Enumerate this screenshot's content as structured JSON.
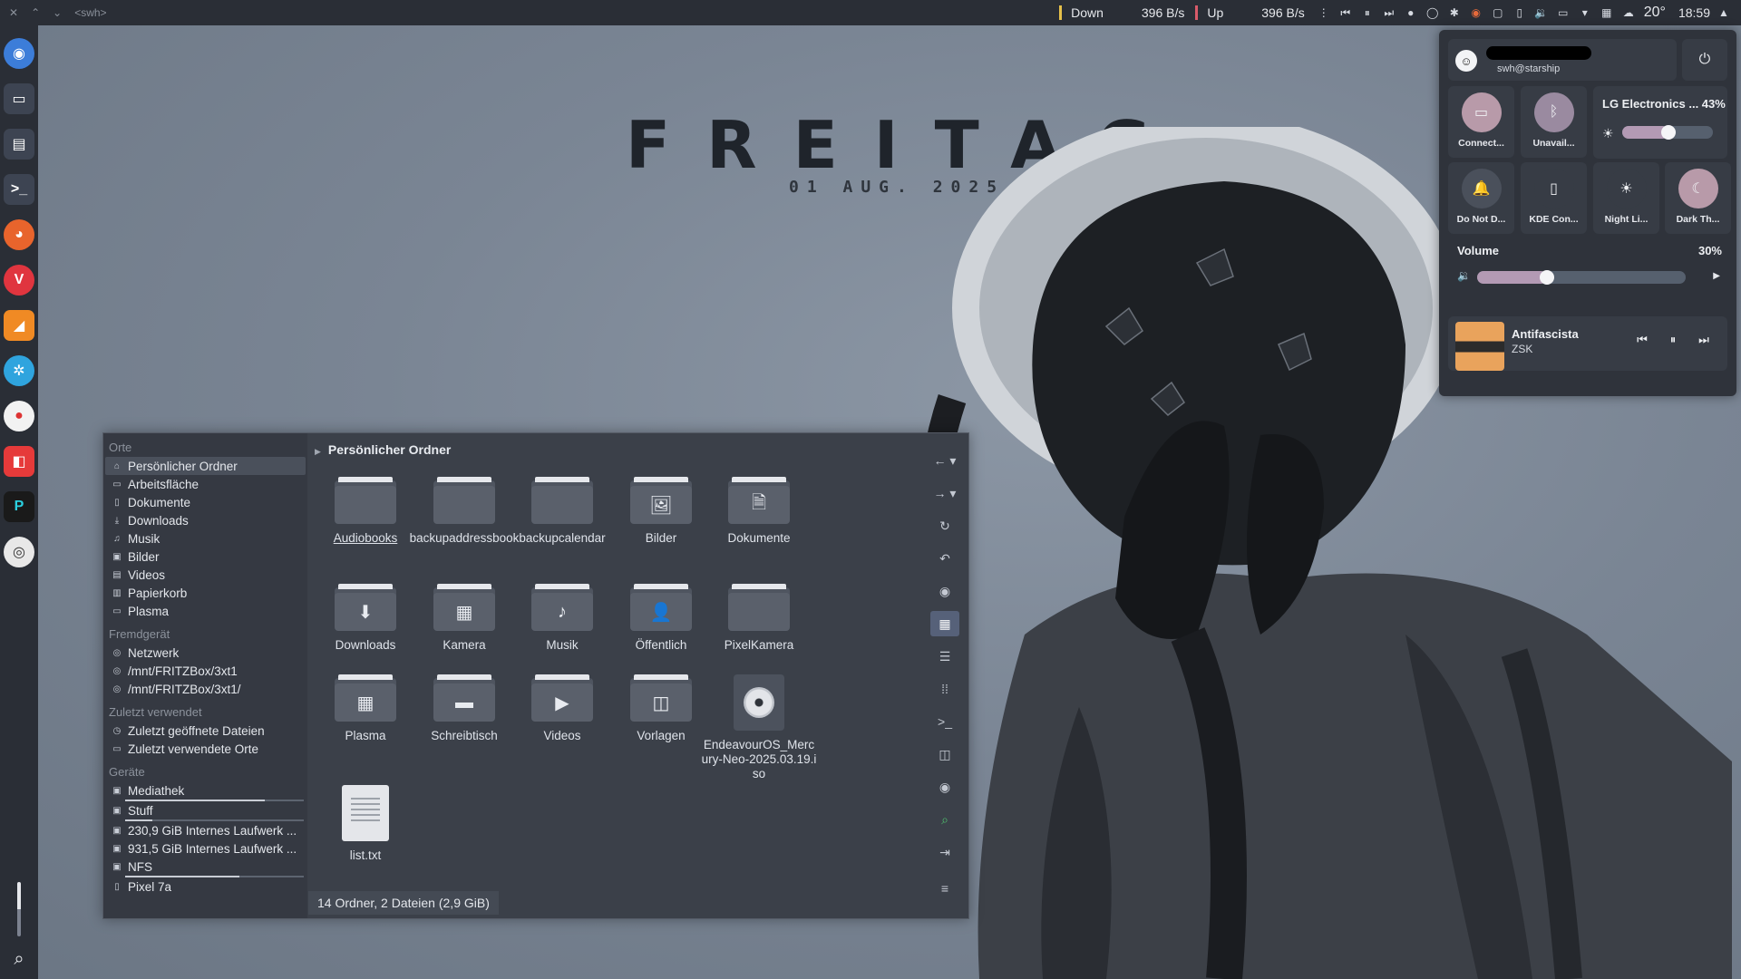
{
  "top_panel": {
    "window_title": "<swh>",
    "down_label": "Down",
    "down_rate": "396 B/s",
    "up_label": "Up",
    "up_rate": "396 B/s",
    "temperature": "20°",
    "clock": "18:59"
  },
  "wallpaper": {
    "title": "FREITAG",
    "date": "01 AUG. 2025"
  },
  "dock": {
    "items": [
      "browser",
      "window",
      "file-manager",
      "terminal",
      "firefox",
      "vivaldi",
      "rss",
      "app",
      "strawberry",
      "app",
      "app",
      "app"
    ]
  },
  "file_manager": {
    "sections": {
      "places": "Orte",
      "remote": "Fremdgerät",
      "recent": "Zuletzt verwendet",
      "devices": "Geräte"
    },
    "places": [
      {
        "label": "Persönlicher Ordner",
        "icon": "home-icon",
        "active": true
      },
      {
        "label": "Arbeitsfläche",
        "icon": "desktop-icon"
      },
      {
        "label": "Dokumente",
        "icon": "document-icon"
      },
      {
        "label": "Downloads",
        "icon": "download-icon"
      },
      {
        "label": "Musik",
        "icon": "music-icon"
      },
      {
        "label": "Bilder",
        "icon": "image-icon"
      },
      {
        "label": "Videos",
        "icon": "video-icon"
      },
      {
        "label": "Papierkorb",
        "icon": "trash-icon"
      },
      {
        "label": "Plasma",
        "icon": "folder-icon"
      }
    ],
    "remote": [
      {
        "label": "Netzwerk",
        "icon": "network-icon"
      },
      {
        "label": "/mnt/FRITZBox/3xt1",
        "icon": "network-icon"
      },
      {
        "label": "/mnt/FRITZBox/3xt1/",
        "icon": "network-icon"
      }
    ],
    "recent": [
      {
        "label": "Zuletzt geöffnete Dateien",
        "icon": "clock-icon"
      },
      {
        "label": "Zuletzt verwendete Orte",
        "icon": "folder-icon"
      }
    ],
    "devices": [
      {
        "label": "Mediathek",
        "icon": "drive-icon",
        "fill": 0.78
      },
      {
        "label": "Stuff",
        "icon": "drive-icon",
        "fill": 0.15
      },
      {
        "label": "230,9 GiB Internes Laufwerk ...",
        "icon": "drive-icon"
      },
      {
        "label": "931,5 GiB Internes Laufwerk ...",
        "icon": "drive-icon"
      },
      {
        "label": "NFS",
        "icon": "drive-icon",
        "fill": 0.64
      },
      {
        "label": "Pixel 7a",
        "icon": "phone-icon"
      }
    ],
    "breadcrumb": "Persönlicher Ordner",
    "files": [
      {
        "name": "Audiobooks",
        "kind": "folder",
        "emblem": ""
      },
      {
        "name": "backupaddressbook",
        "kind": "folder",
        "emblem": ""
      },
      {
        "name": "backupcalendar",
        "kind": "folder",
        "emblem": ""
      },
      {
        "name": "Bilder",
        "kind": "folder",
        "emblem": "🖼"
      },
      {
        "name": "Dokumente",
        "kind": "folder",
        "emblem": "🗎"
      },
      {
        "name": "Downloads",
        "kind": "folder",
        "emblem": "⬇"
      },
      {
        "name": "Kamera",
        "kind": "folder",
        "emblem": "▦"
      },
      {
        "name": "Musik",
        "kind": "folder",
        "emblem": "♪"
      },
      {
        "name": "Öffentlich",
        "kind": "folder",
        "emblem": "👤"
      },
      {
        "name": "PixelKamera",
        "kind": "folder",
        "emblem": ""
      },
      {
        "name": "Plasma",
        "kind": "folder",
        "emblem": "▦"
      },
      {
        "name": "Schreibtisch",
        "kind": "folder",
        "emblem": "▬"
      },
      {
        "name": "Videos",
        "kind": "folder",
        "emblem": "▶"
      },
      {
        "name": "Vorlagen",
        "kind": "folder",
        "emblem": "◫"
      },
      {
        "name": "EndeavourOS_Mercury-Neo-2025.03.19.iso",
        "kind": "iso"
      },
      {
        "name": "list.txt",
        "kind": "text"
      }
    ],
    "status": "14 Ordner, 2 Dateien (2,9 GiB)"
  },
  "quick_settings": {
    "user_host": "swh@starship",
    "tiles": [
      {
        "label": "Connect...",
        "icon": "display-icon",
        "color": "#b89aa9"
      },
      {
        "label": "Unavail...",
        "icon": "bluetooth-icon",
        "color": "#9a8aa0"
      },
      {
        "label": "Do Not D...",
        "icon": "bell-icon",
        "color": "#4a505b"
      },
      {
        "label": "KDE Con...",
        "icon": "phone-icon",
        "color": "#373c45"
      },
      {
        "label": "Night Li...",
        "icon": "night-light-icon",
        "color": "#373c45"
      },
      {
        "label": "Dark Th...",
        "icon": "moon-icon",
        "color": "#b89aa9"
      }
    ],
    "brightness_title": "LG Electronics ... 43%",
    "brightness_level": 0.43,
    "volume_title": "Volume",
    "volume_pct": "30%",
    "volume_level": 0.3,
    "media": {
      "title": "Antifascista",
      "artist": "ZSK"
    }
  }
}
